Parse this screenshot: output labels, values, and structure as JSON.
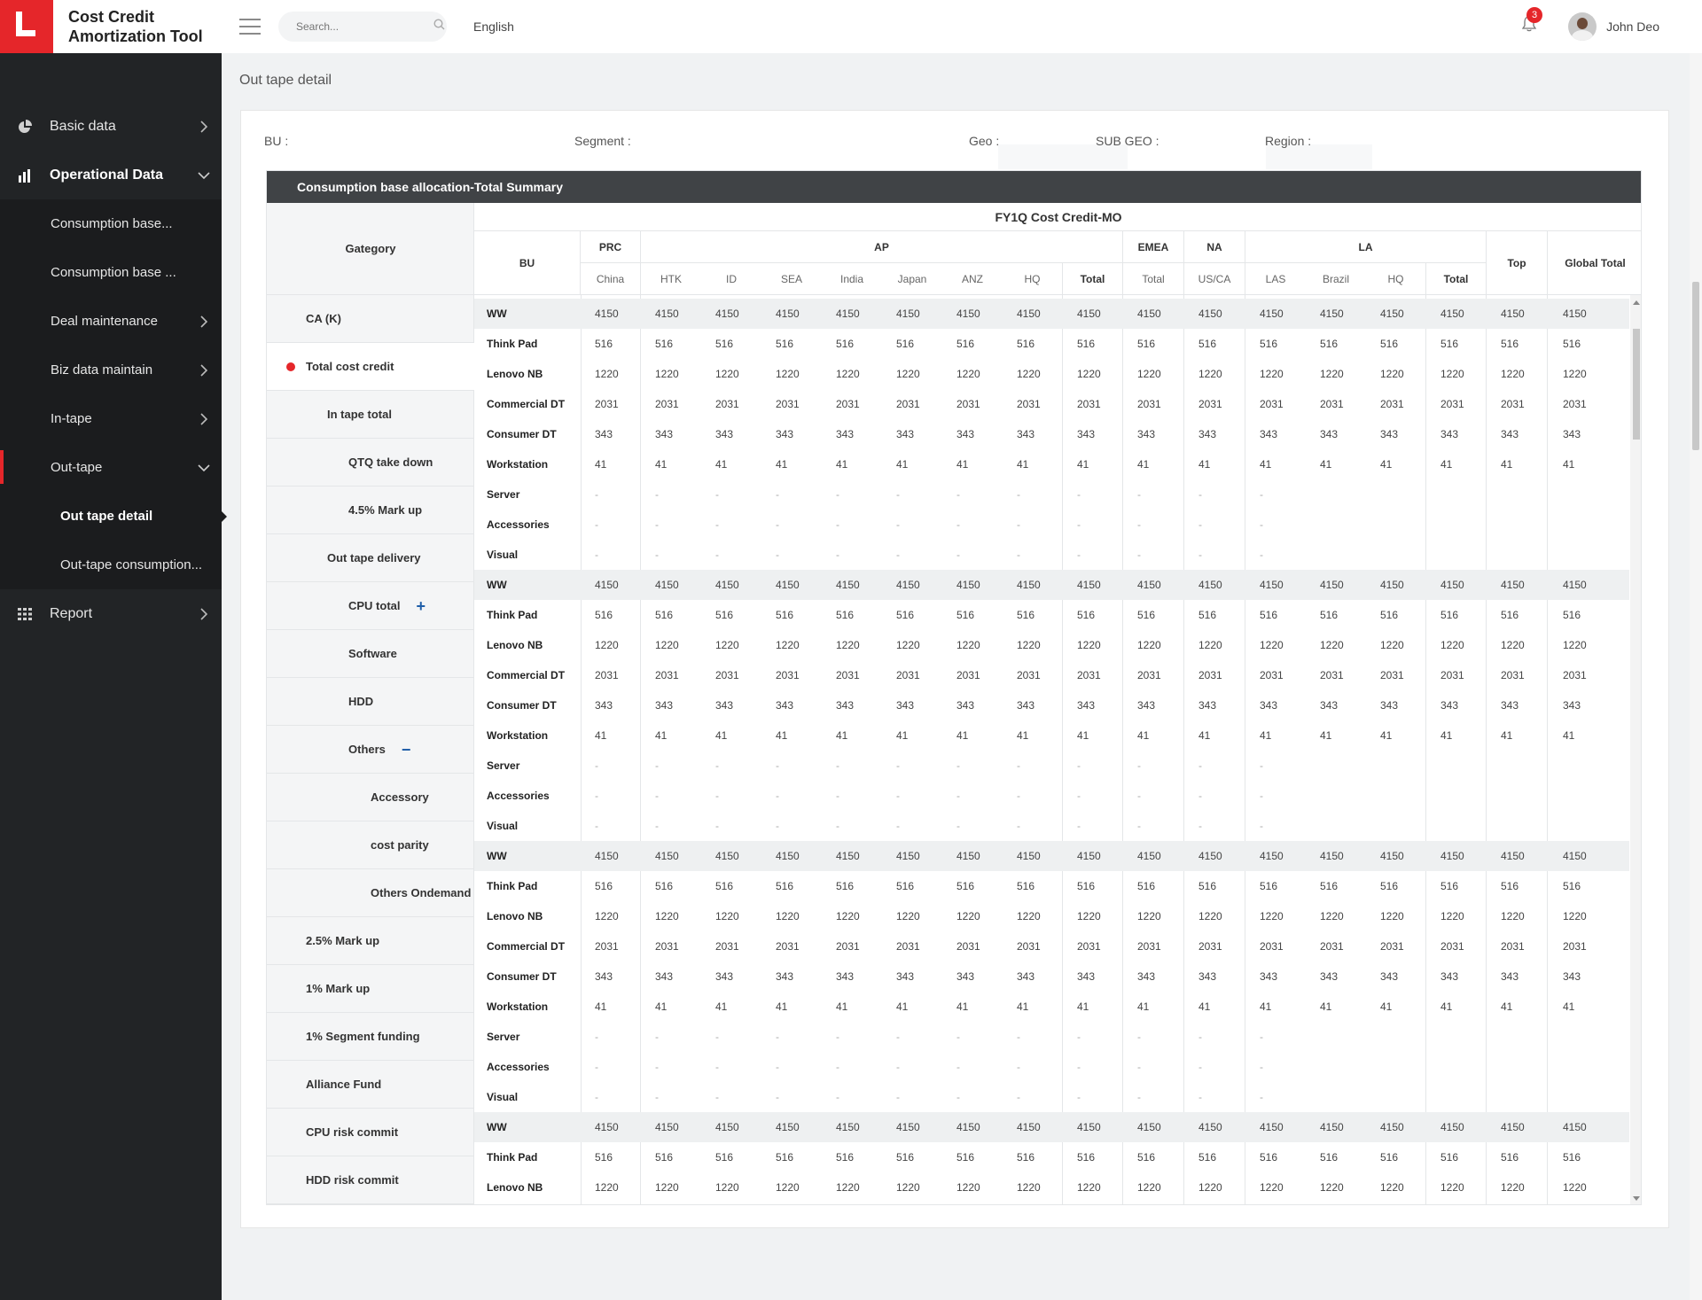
{
  "app": {
    "title": "Cost Credit Amortization Tool"
  },
  "header": {
    "search_placeholder": "Search...",
    "language": "English",
    "notifications_count": "3",
    "user_name": "John Deo"
  },
  "sidebar": {
    "basic_data": "Basic data",
    "operational_data": "Operational Data",
    "consumption_base_1": "Consumption base...",
    "consumption_base_2": "Consumption base ...",
    "deal_maintenance": "Deal maintenance",
    "biz_data_maintain": "Biz data maintain",
    "in_tape": "In-tape",
    "out_tape": "Out-tape",
    "out_tape_detail": "Out tape detail",
    "out_tape_consumption": "Out-tape consumption...",
    "report": "Report"
  },
  "page": {
    "title": "Out tape detail"
  },
  "filters": {
    "bu": "BU :",
    "segment": "Segment :",
    "geo": "Geo :",
    "sub_geo": "SUB GEO :",
    "region": "Region :"
  },
  "table": {
    "title": "Consumption base allocation-Total Summary",
    "fy_title": "FY1Q Cost Credit-MO",
    "category_header": "Gategory",
    "bu_header": "BU",
    "groups": {
      "prc": "PRC",
      "ap": "AP",
      "emea": "EMEA",
      "na": "NA",
      "la": "LA",
      "top": "Top",
      "global_total": "Global Total"
    },
    "subcols": {
      "china": "China",
      "htk": "HTK",
      "id": "ID",
      "sea": "SEA",
      "india": "India",
      "japan": "Japan",
      "anz": "ANZ",
      "hq": "HQ",
      "ap_total": "Total",
      "emea_total": "Total",
      "usca": "US/CA",
      "las": "LAS",
      "brazil": "Brazil",
      "la_hq": "HQ",
      "la_total": "Total"
    },
    "categories": [
      "CA (K)",
      "Total cost credit",
      "In tape total",
      "QTQ take down",
      "4.5% Mark up",
      "Out tape delivery",
      "CPU total",
      "Software",
      "HDD",
      "Others",
      "Accessory",
      "cost parity",
      "Others Ondemand",
      "2.5% Mark up",
      "1% Mark up",
      "1% Segment funding",
      "Alliance Fund",
      "CPU risk commit",
      "HDD risk commit"
    ],
    "rows": [
      {
        "bu": "WW",
        "vals": [
          "4150",
          "4150",
          "4150",
          "4150",
          "4150",
          "4150",
          "4150",
          "4150",
          "4150",
          "4150",
          "4150",
          "4150",
          "4150",
          "4150",
          "4150",
          "4150",
          "4150"
        ]
      },
      {
        "bu": "Think Pad",
        "vals": [
          "516",
          "516",
          "516",
          "516",
          "516",
          "516",
          "516",
          "516",
          "516",
          "516",
          "516",
          "516",
          "516",
          "516",
          "516",
          "516",
          "516"
        ]
      },
      {
        "bu": "Lenovo NB",
        "vals": [
          "1220",
          "1220",
          "1220",
          "1220",
          "1220",
          "1220",
          "1220",
          "1220",
          "1220",
          "1220",
          "1220",
          "1220",
          "1220",
          "1220",
          "1220",
          "1220",
          "1220"
        ]
      },
      {
        "bu": "Commercial DT",
        "vals": [
          "2031",
          "2031",
          "2031",
          "2031",
          "2031",
          "2031",
          "2031",
          "2031",
          "2031",
          "2031",
          "2031",
          "2031",
          "2031",
          "2031",
          "2031",
          "2031",
          "2031"
        ]
      },
      {
        "bu": "Consumer DT",
        "vals": [
          "343",
          "343",
          "343",
          "343",
          "343",
          "343",
          "343",
          "343",
          "343",
          "343",
          "343",
          "343",
          "343",
          "343",
          "343",
          "343",
          "343"
        ]
      },
      {
        "bu": "Workstation",
        "vals": [
          "41",
          "41",
          "41",
          "41",
          "41",
          "41",
          "41",
          "41",
          "41",
          "41",
          "41",
          "41",
          "41",
          "41",
          "41",
          "41",
          "41"
        ]
      },
      {
        "bu": "Server",
        "vals": [
          "-",
          "-",
          "-",
          "-",
          "-",
          "-",
          "-",
          "-",
          "-",
          "-",
          "-",
          "-",
          "",
          "",
          "",
          "",
          ""
        ]
      },
      {
        "bu": "Accessories",
        "vals": [
          "-",
          "-",
          "-",
          "-",
          "-",
          "-",
          "-",
          "-",
          "-",
          "-",
          "-",
          "-",
          "",
          "",
          "",
          "",
          ""
        ]
      },
      {
        "bu": "Visual",
        "vals": [
          "-",
          "-",
          "-",
          "-",
          "-",
          "-",
          "-",
          "-",
          "-",
          "-",
          "-",
          "-",
          "",
          "",
          "",
          "",
          ""
        ]
      },
      {
        "bu": "WW",
        "vals": [
          "4150",
          "4150",
          "4150",
          "4150",
          "4150",
          "4150",
          "4150",
          "4150",
          "4150",
          "4150",
          "4150",
          "4150",
          "4150",
          "4150",
          "4150",
          "4150",
          "4150"
        ]
      },
      {
        "bu": "Think Pad",
        "vals": [
          "516",
          "516",
          "516",
          "516",
          "516",
          "516",
          "516",
          "516",
          "516",
          "516",
          "516",
          "516",
          "516",
          "516",
          "516",
          "516",
          "516"
        ]
      },
      {
        "bu": "Lenovo NB",
        "vals": [
          "1220",
          "1220",
          "1220",
          "1220",
          "1220",
          "1220",
          "1220",
          "1220",
          "1220",
          "1220",
          "1220",
          "1220",
          "1220",
          "1220",
          "1220",
          "1220",
          "1220"
        ]
      },
      {
        "bu": "Commercial DT",
        "vals": [
          "2031",
          "2031",
          "2031",
          "2031",
          "2031",
          "2031",
          "2031",
          "2031",
          "2031",
          "2031",
          "2031",
          "2031",
          "2031",
          "2031",
          "2031",
          "2031",
          "2031"
        ]
      },
      {
        "bu": "Consumer DT",
        "vals": [
          "343",
          "343",
          "343",
          "343",
          "343",
          "343",
          "343",
          "343",
          "343",
          "343",
          "343",
          "343",
          "343",
          "343",
          "343",
          "343",
          "343"
        ]
      },
      {
        "bu": "Workstation",
        "vals": [
          "41",
          "41",
          "41",
          "41",
          "41",
          "41",
          "41",
          "41",
          "41",
          "41",
          "41",
          "41",
          "41",
          "41",
          "41",
          "41",
          "41"
        ]
      },
      {
        "bu": "Server",
        "vals": [
          "-",
          "-",
          "-",
          "-",
          "-",
          "-",
          "-",
          "-",
          "-",
          "-",
          "-",
          "-",
          "",
          "",
          "",
          "",
          ""
        ]
      },
      {
        "bu": "Accessories",
        "vals": [
          "-",
          "-",
          "-",
          "-",
          "-",
          "-",
          "-",
          "-",
          "-",
          "-",
          "-",
          "-",
          "",
          "",
          "",
          "",
          ""
        ]
      },
      {
        "bu": "Visual",
        "vals": [
          "-",
          "-",
          "-",
          "-",
          "-",
          "-",
          "-",
          "-",
          "-",
          "-",
          "-",
          "-",
          "",
          "",
          "",
          "",
          ""
        ]
      },
      {
        "bu": "WW",
        "vals": [
          "4150",
          "4150",
          "4150",
          "4150",
          "4150",
          "4150",
          "4150",
          "4150",
          "4150",
          "4150",
          "4150",
          "4150",
          "4150",
          "4150",
          "4150",
          "4150",
          "4150"
        ]
      },
      {
        "bu": "Think Pad",
        "vals": [
          "516",
          "516",
          "516",
          "516",
          "516",
          "516",
          "516",
          "516",
          "516",
          "516",
          "516",
          "516",
          "516",
          "516",
          "516",
          "516",
          "516"
        ]
      },
      {
        "bu": "Lenovo NB",
        "vals": [
          "1220",
          "1220",
          "1220",
          "1220",
          "1220",
          "1220",
          "1220",
          "1220",
          "1220",
          "1220",
          "1220",
          "1220",
          "1220",
          "1220",
          "1220",
          "1220",
          "1220"
        ]
      },
      {
        "bu": "Commercial DT",
        "vals": [
          "2031",
          "2031",
          "2031",
          "2031",
          "2031",
          "2031",
          "2031",
          "2031",
          "2031",
          "2031",
          "2031",
          "2031",
          "2031",
          "2031",
          "2031",
          "2031",
          "2031"
        ]
      },
      {
        "bu": "Consumer DT",
        "vals": [
          "343",
          "343",
          "343",
          "343",
          "343",
          "343",
          "343",
          "343",
          "343",
          "343",
          "343",
          "343",
          "343",
          "343",
          "343",
          "343",
          "343"
        ]
      },
      {
        "bu": "Workstation",
        "vals": [
          "41",
          "41",
          "41",
          "41",
          "41",
          "41",
          "41",
          "41",
          "41",
          "41",
          "41",
          "41",
          "41",
          "41",
          "41",
          "41",
          "41"
        ]
      },
      {
        "bu": "Server",
        "vals": [
          "-",
          "-",
          "-",
          "-",
          "-",
          "-",
          "-",
          "-",
          "-",
          "-",
          "-",
          "-",
          "",
          "",
          "",
          "",
          ""
        ]
      },
      {
        "bu": "Accessories",
        "vals": [
          "-",
          "-",
          "-",
          "-",
          "-",
          "-",
          "-",
          "-",
          "-",
          "-",
          "-",
          "-",
          "",
          "",
          "",
          "",
          ""
        ]
      },
      {
        "bu": "Visual",
        "vals": [
          "-",
          "-",
          "-",
          "-",
          "-",
          "-",
          "-",
          "-",
          "-",
          "-",
          "-",
          "-",
          "",
          "",
          "",
          "",
          ""
        ]
      },
      {
        "bu": "WW",
        "vals": [
          "4150",
          "4150",
          "4150",
          "4150",
          "4150",
          "4150",
          "4150",
          "4150",
          "4150",
          "4150",
          "4150",
          "4150",
          "4150",
          "4150",
          "4150",
          "4150",
          "4150"
        ]
      },
      {
        "bu": "Think Pad",
        "vals": [
          "516",
          "516",
          "516",
          "516",
          "516",
          "516",
          "516",
          "516",
          "516",
          "516",
          "516",
          "516",
          "516",
          "516",
          "516",
          "516",
          "516"
        ]
      },
      {
        "bu": "Lenovo NB",
        "vals": [
          "1220",
          "1220",
          "1220",
          "1220",
          "1220",
          "1220",
          "1220",
          "1220",
          "1220",
          "1220",
          "1220",
          "1220",
          "1220",
          "1220",
          "1220",
          "1220",
          "1220"
        ]
      }
    ]
  },
  "colors": {
    "accent": "#e5262a",
    "sidebar_bg": "#222426",
    "table_header_bg": "#404346",
    "icon_blue": "#1f5ea8"
  }
}
